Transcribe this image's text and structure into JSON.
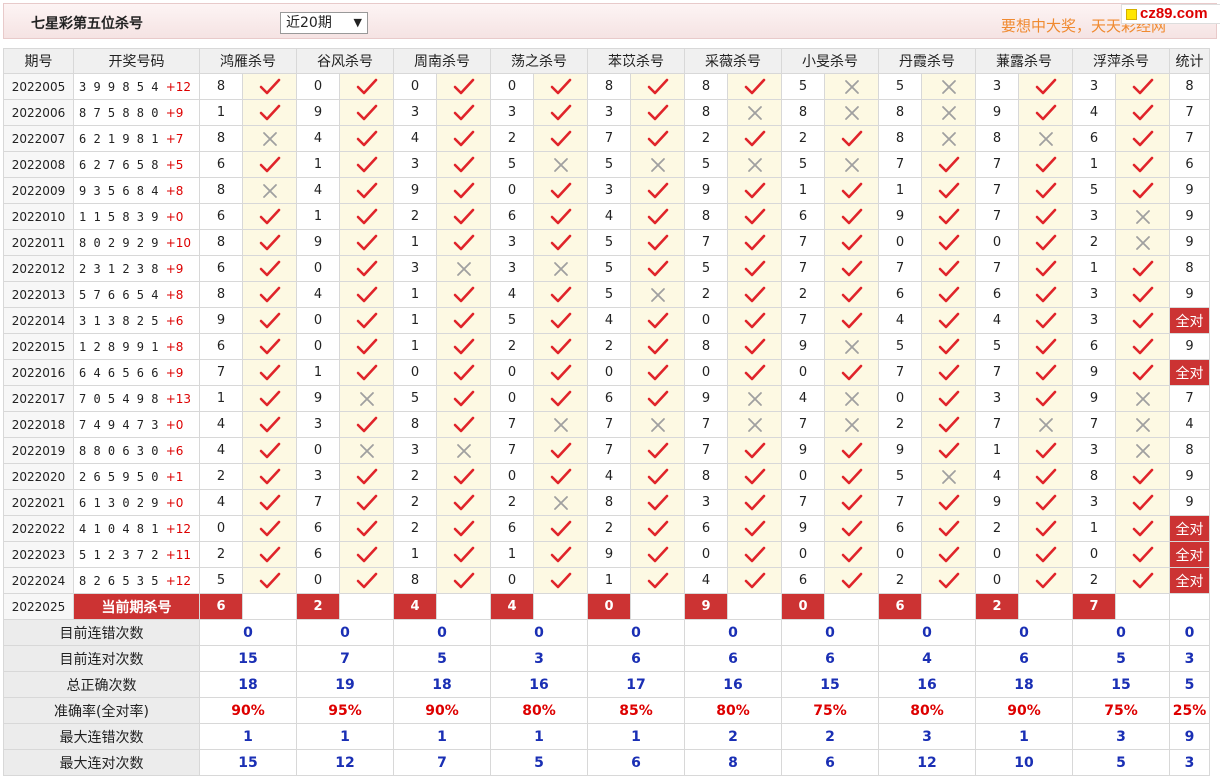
{
  "header": {
    "title": "七星彩第五位杀号",
    "period_select": "近20期",
    "slogan": "要想中大奖，天天彩经网",
    "logo_text": "cz89.com"
  },
  "table": {
    "col_period": "期号",
    "col_numbers": "开奖号码",
    "experts": [
      "鸿雁杀号",
      "谷风杀号",
      "周南杀号",
      "荡之杀号",
      "苯苡杀号",
      "采薇杀号",
      "小旻杀号",
      "丹霞杀号",
      "蒹露杀号",
      "浮萍杀号"
    ],
    "col_stat": "统计",
    "rows": [
      {
        "period": "2022005",
        "nums": "3 9 9 8 5 4",
        "extra": "+12",
        "kills": [
          "8",
          "0",
          "0",
          "0",
          "8",
          "8",
          "5",
          "5",
          "3",
          "3"
        ],
        "ok": [
          1,
          1,
          1,
          1,
          1,
          1,
          0,
          0,
          1,
          1
        ],
        "stat": "8"
      },
      {
        "period": "2022006",
        "nums": "8 7 5 8 8 0",
        "extra": "+9",
        "kills": [
          "1",
          "9",
          "3",
          "3",
          "3",
          "8",
          "8",
          "8",
          "9",
          "4"
        ],
        "ok": [
          1,
          1,
          1,
          1,
          1,
          0,
          0,
          0,
          1,
          1
        ],
        "stat": "7"
      },
      {
        "period": "2022007",
        "nums": "6 2 1 9 8 1",
        "extra": "+7",
        "kills": [
          "8",
          "4",
          "4",
          "2",
          "7",
          "2",
          "2",
          "8",
          "8",
          "6"
        ],
        "ok": [
          0,
          1,
          1,
          1,
          1,
          1,
          1,
          0,
          0,
          1
        ],
        "stat": "7"
      },
      {
        "period": "2022008",
        "nums": "6 2 7 6 5 8",
        "extra": "+5",
        "kills": [
          "6",
          "1",
          "3",
          "5",
          "5",
          "5",
          "5",
          "7",
          "7",
          "1"
        ],
        "ok": [
          1,
          1,
          1,
          0,
          0,
          0,
          0,
          1,
          1,
          1
        ],
        "stat": "6"
      },
      {
        "period": "2022009",
        "nums": "9 3 5 6 8 4",
        "extra": "+8",
        "kills": [
          "8",
          "4",
          "9",
          "0",
          "3",
          "9",
          "1",
          "1",
          "7",
          "5"
        ],
        "ok": [
          0,
          1,
          1,
          1,
          1,
          1,
          1,
          1,
          1,
          1
        ],
        "stat": "9"
      },
      {
        "period": "2022010",
        "nums": "1 1 5 8 3 9",
        "extra": "+0",
        "kills": [
          "6",
          "1",
          "2",
          "6",
          "4",
          "8",
          "6",
          "9",
          "7",
          "3"
        ],
        "ok": [
          1,
          1,
          1,
          1,
          1,
          1,
          1,
          1,
          1,
          0
        ],
        "stat": "9"
      },
      {
        "period": "2022011",
        "nums": "8 0 2 9 2 9",
        "extra": "+10",
        "kills": [
          "8",
          "9",
          "1",
          "3",
          "5",
          "7",
          "7",
          "0",
          "0",
          "2"
        ],
        "ok": [
          1,
          1,
          1,
          1,
          1,
          1,
          1,
          1,
          1,
          0
        ],
        "stat": "9"
      },
      {
        "period": "2022012",
        "nums": "2 3 1 2 3 8",
        "extra": "+9",
        "kills": [
          "6",
          "0",
          "3",
          "3",
          "5",
          "5",
          "7",
          "7",
          "7",
          "1"
        ],
        "ok": [
          1,
          1,
          0,
          0,
          1,
          1,
          1,
          1,
          1,
          1
        ],
        "stat": "8"
      },
      {
        "period": "2022013",
        "nums": "5 7 6 6 5 4",
        "extra": "+8",
        "kills": [
          "8",
          "4",
          "1",
          "4",
          "5",
          "2",
          "2",
          "6",
          "6",
          "3"
        ],
        "ok": [
          1,
          1,
          1,
          1,
          0,
          1,
          1,
          1,
          1,
          1
        ],
        "stat": "9"
      },
      {
        "period": "2022014",
        "nums": "3 1 3 8 2 5",
        "extra": "+6",
        "kills": [
          "9",
          "0",
          "1",
          "5",
          "4",
          "0",
          "7",
          "4",
          "4",
          "3"
        ],
        "ok": [
          1,
          1,
          1,
          1,
          1,
          1,
          1,
          1,
          1,
          1
        ],
        "stat": "全对"
      },
      {
        "period": "2022015",
        "nums": "1 2 8 9 9 1",
        "extra": "+8",
        "kills": [
          "6",
          "0",
          "1",
          "2",
          "2",
          "8",
          "9",
          "5",
          "5",
          "6"
        ],
        "ok": [
          1,
          1,
          1,
          1,
          1,
          1,
          0,
          1,
          1,
          1
        ],
        "stat": "9"
      },
      {
        "period": "2022016",
        "nums": "6 4 6 5 6 6",
        "extra": "+9",
        "kills": [
          "7",
          "1",
          "0",
          "0",
          "0",
          "0",
          "0",
          "7",
          "7",
          "9"
        ],
        "ok": [
          1,
          1,
          1,
          1,
          1,
          1,
          1,
          1,
          1,
          1
        ],
        "stat": "全对"
      },
      {
        "period": "2022017",
        "nums": "7 0 5 4 9 8",
        "extra": "+13",
        "kills": [
          "1",
          "9",
          "5",
          "0",
          "6",
          "9",
          "4",
          "0",
          "3",
          "9"
        ],
        "ok": [
          1,
          0,
          1,
          1,
          1,
          0,
          0,
          1,
          1,
          0
        ],
        "stat": "7"
      },
      {
        "period": "2022018",
        "nums": "7 4 9 4 7 3",
        "extra": "+0",
        "kills": [
          "4",
          "3",
          "8",
          "7",
          "7",
          "7",
          "7",
          "2",
          "7",
          "7"
        ],
        "ok": [
          1,
          1,
          1,
          0,
          0,
          0,
          0,
          1,
          0,
          0
        ],
        "stat": "4"
      },
      {
        "period": "2022019",
        "nums": "8 8 0 6 3 0",
        "extra": "+6",
        "kills": [
          "4",
          "0",
          "3",
          "7",
          "7",
          "7",
          "9",
          "9",
          "1",
          "3"
        ],
        "ok": [
          1,
          0,
          0,
          1,
          1,
          1,
          1,
          1,
          1,
          0
        ],
        "stat": "8"
      },
      {
        "period": "2022020",
        "nums": "2 6 5 9 5 0",
        "extra": "+1",
        "kills": [
          "2",
          "3",
          "2",
          "0",
          "4",
          "8",
          "0",
          "5",
          "4",
          "8"
        ],
        "ok": [
          1,
          1,
          1,
          1,
          1,
          1,
          1,
          0,
          1,
          1
        ],
        "stat": "9"
      },
      {
        "period": "2022021",
        "nums": "6 1 3 0 2 9",
        "extra": "+0",
        "kills": [
          "4",
          "7",
          "2",
          "2",
          "8",
          "3",
          "7",
          "7",
          "9",
          "3"
        ],
        "ok": [
          1,
          1,
          1,
          0,
          1,
          1,
          1,
          1,
          1,
          1
        ],
        "stat": "9"
      },
      {
        "period": "2022022",
        "nums": "4 1 0 4 8 1",
        "extra": "+12",
        "kills": [
          "0",
          "6",
          "2",
          "6",
          "2",
          "6",
          "9",
          "6",
          "2",
          "1"
        ],
        "ok": [
          1,
          1,
          1,
          1,
          1,
          1,
          1,
          1,
          1,
          1
        ],
        "stat": "全对"
      },
      {
        "period": "2022023",
        "nums": "5 1 2 3 7 2",
        "extra": "+11",
        "kills": [
          "2",
          "6",
          "1",
          "1",
          "9",
          "0",
          "0",
          "0",
          "0",
          "0"
        ],
        "ok": [
          1,
          1,
          1,
          1,
          1,
          1,
          1,
          1,
          1,
          1
        ],
        "stat": "全对"
      },
      {
        "period": "2022024",
        "nums": "8 2 6 5 3 5",
        "extra": "+12",
        "kills": [
          "5",
          "0",
          "8",
          "0",
          "1",
          "4",
          "6",
          "2",
          "0",
          "2"
        ],
        "ok": [
          1,
          1,
          1,
          1,
          1,
          1,
          1,
          1,
          1,
          1
        ],
        "stat": "全对"
      }
    ],
    "current": {
      "period": "2022025",
      "label": "当前期杀号",
      "kills": [
        "6",
        "2",
        "4",
        "4",
        "0",
        "9",
        "0",
        "6",
        "2",
        "7"
      ]
    },
    "summary": [
      {
        "label": "目前连错次数",
        "values": [
          "0",
          "0",
          "0",
          "0",
          "0",
          "0",
          "0",
          "0",
          "0",
          "0"
        ],
        "stat": "0",
        "red": false
      },
      {
        "label": "目前连对次数",
        "values": [
          "15",
          "7",
          "5",
          "3",
          "6",
          "6",
          "6",
          "4",
          "6",
          "5"
        ],
        "stat": "3",
        "red": false
      },
      {
        "label": "总正确次数",
        "values": [
          "18",
          "19",
          "18",
          "16",
          "17",
          "16",
          "15",
          "16",
          "18",
          "15"
        ],
        "stat": "5",
        "red": false
      },
      {
        "label": "准确率(全对率)",
        "values": [
          "90%",
          "95%",
          "90%",
          "80%",
          "85%",
          "80%",
          "75%",
          "80%",
          "90%",
          "75%"
        ],
        "stat": "25%",
        "red": true
      },
      {
        "label": "最大连错次数",
        "values": [
          "1",
          "1",
          "1",
          "1",
          "1",
          "2",
          "2",
          "3",
          "1",
          "3"
        ],
        "stat": "9",
        "red": false
      },
      {
        "label": "最大连对次数",
        "values": [
          "15",
          "12",
          "7",
          "5",
          "6",
          "8",
          "6",
          "12",
          "10",
          "5"
        ],
        "stat": "3",
        "red": false
      }
    ]
  },
  "colors": {
    "check": "#e0242a",
    "cross": "#a0a0a0",
    "accent": "#cc3333",
    "stat_blue": "#1a2fb4"
  }
}
